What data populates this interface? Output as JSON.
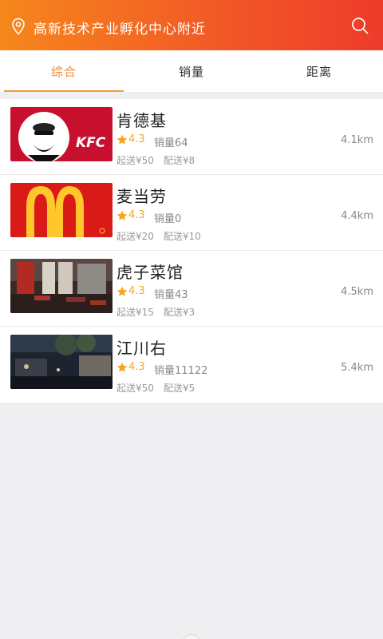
{
  "header": {
    "location": "高新技术产业孵化中心附近",
    "location_icon": "map-pin-icon",
    "search_icon": "search-icon",
    "colors": {
      "start": "#f6871c",
      "end": "#ee3b2b"
    }
  },
  "tabs": [
    {
      "label": "综合",
      "active": true
    },
    {
      "label": "销量",
      "active": false
    },
    {
      "label": "距离",
      "active": false
    }
  ],
  "stores": [
    {
      "name": "肯德基",
      "rating": "4.3",
      "sales": "销量64",
      "distance": "4.1km",
      "min_order": "起送¥50",
      "delivery": "配送¥8",
      "image": "kfc-logo"
    },
    {
      "name": "麦当劳",
      "rating": "4.3",
      "sales": "销量0",
      "distance": "4.4km",
      "min_order": "起送¥20",
      "delivery": "配送¥10",
      "image": "mcdonalds-logo"
    },
    {
      "name": "虎子菜馆",
      "rating": "4.3",
      "sales": "销量43",
      "distance": "4.5km",
      "min_order": "起送¥15",
      "delivery": "配送¥3",
      "image": "restaurant-interior"
    },
    {
      "name": "江川右",
      "rating": "4.3",
      "sales": "销量11122",
      "distance": "5.4km",
      "min_order": "起送¥50",
      "delivery": "配送¥5",
      "image": "night-street"
    }
  ],
  "thumb_text": {
    "kfc": "KFC"
  },
  "accent": "#f28a2e",
  "star_color": "#f6a623"
}
